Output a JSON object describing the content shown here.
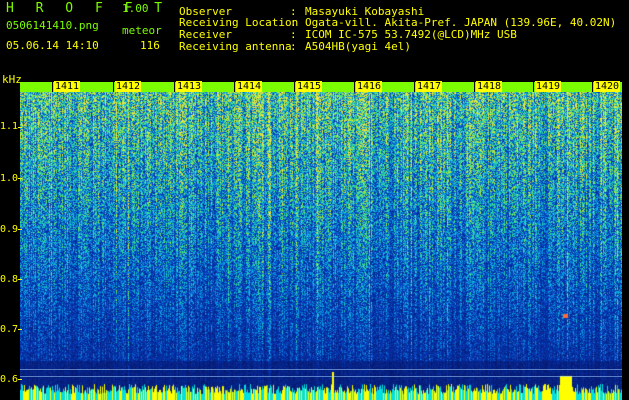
{
  "header": {
    "logo": "H R O F F T",
    "version": "1.00",
    "filename": "0506141410.png",
    "mode": "meteor",
    "timestamp": "05.06.14 14:10",
    "count": "116"
  },
  "info": [
    {
      "key": "Observer",
      "value": "Masayuki Kobayashi"
    },
    {
      "key": "Receiving Location",
      "value": "Ogata-vill. Akita-Pref. JAPAN (139.96E, 40.02N)"
    },
    {
      "key": "Receiver",
      "value": "ICOM IC-575 53.7492(@LCD)MHz USB"
    },
    {
      "key": "Receiving antenna",
      "value": "A504HB(yagi 4el)"
    }
  ],
  "separator": ":",
  "yaxis": {
    "unit": "kHz",
    "labels": [
      "1.1",
      "1.0",
      "0.9",
      "0.8",
      "0.7",
      "0.6"
    ]
  },
  "xaxis": {
    "labels": [
      "1411",
      "1412",
      "1413",
      "1414",
      "1415",
      "1416",
      "1417",
      "1418",
      "1419",
      "1420"
    ]
  },
  "colors": {
    "text_green": "#7CFC00",
    "text_yellow": "#FFFF00",
    "spectrum_low": "#06105a",
    "spectrum_high": "#1fd8c8"
  }
}
